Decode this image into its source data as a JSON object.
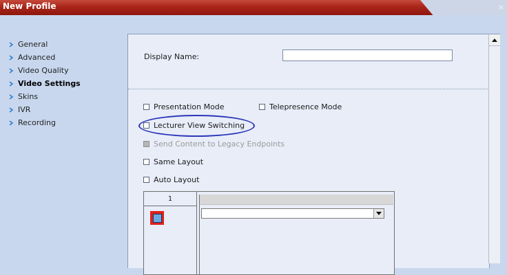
{
  "window": {
    "title": "New Profile",
    "close_glyph": "×"
  },
  "nav": {
    "items": [
      {
        "label": "General",
        "active": false
      },
      {
        "label": "Advanced",
        "active": false
      },
      {
        "label": "Video Quality",
        "active": false
      },
      {
        "label": "Video Settings",
        "active": true
      },
      {
        "label": "Skins",
        "active": false
      },
      {
        "label": "IVR",
        "active": false
      },
      {
        "label": "Recording",
        "active": false
      }
    ]
  },
  "form": {
    "display_name_label": "Display Name:",
    "display_name_value": "",
    "checkboxes": {
      "presentation_mode": {
        "label": "Presentation Mode",
        "checked": false
      },
      "telepresence_mode": {
        "label": "Telepresence Mode",
        "checked": false
      },
      "lecturer_view_switching": {
        "label": "Lecturer View Switching",
        "checked": false
      },
      "send_content_legacy": {
        "label": "Send Content to Legacy Endpoints",
        "checked": false,
        "disabled": true
      },
      "same_layout": {
        "label": "Same Layout",
        "checked": false
      },
      "auto_layout": {
        "label": "Auto Layout",
        "checked": false
      }
    },
    "layout_table": {
      "column_header": "1"
    }
  },
  "colors": {
    "title_red": "#a92519",
    "highlight_oval": "#2b35b8",
    "panel_bg": "#e8edf8",
    "page_bg": "#c8d7ee"
  },
  "icons": {
    "nav_bullet": "chevron-right-icon",
    "dropdown": "chevron-down-icon",
    "scroll_up": "arrow-up-icon"
  }
}
